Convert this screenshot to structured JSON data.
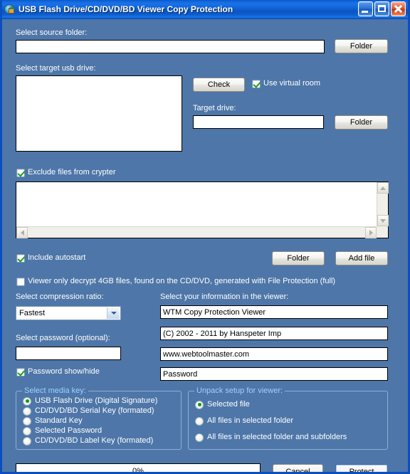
{
  "window": {
    "title": "USB Flash Drive/CD/DVD/BD Viewer Copy Protection",
    "icon": "disc-house-icon",
    "minimize_label": "Minimize",
    "maximize_label": "Maximize",
    "close_label": "Close",
    "accent_titlebar": "#1266dc",
    "background": "#4e76a8",
    "border": "#0a4fbd"
  },
  "source": {
    "label": "Select source folder:",
    "value": "",
    "folder_button": "Folder"
  },
  "target": {
    "label": "Select target usb drive:",
    "list_value": "",
    "check_button": "Check",
    "virtual_room_checkbox": "Use virtual room",
    "virtual_room_checked": true,
    "drive_label": "Target drive:",
    "drive_value": "",
    "drive_folder_button": "Folder"
  },
  "exclude": {
    "checkbox_label": "Exclude files from crypter",
    "checked": true,
    "list_value": ""
  },
  "autostart": {
    "checkbox_label": "Include autostart",
    "checked": true,
    "folder_button": "Folder",
    "add_file_button": "Add file"
  },
  "viewer_decrypt": {
    "checkbox_label": "Viewer only decrypt 4GB files, found on the CD/DVD, generated with File Protection (full)",
    "checked": false
  },
  "compression": {
    "label": "Select compression ratio:",
    "selected": "Fastest",
    "options": [
      "Fastest"
    ]
  },
  "password": {
    "label": "Select password (optional):",
    "value": "",
    "show_hide_checkbox": "Password show/hide",
    "show_hide_checked": true
  },
  "viewer_info": {
    "label": "Select your information in the viewer:",
    "line1": "WTM Copy Protection Viewer",
    "line2": "(C) 2002 - 2011 by Hanspeter Imp",
    "line3": "www.webtoolmaster.com",
    "line4": "Password"
  },
  "media_key": {
    "title": "Select media key:",
    "options": [
      {
        "label": "USB Flash Drive (Digital Signature)",
        "selected": true
      },
      {
        "label": "CD/DVD/BD Serial Key (formated)",
        "selected": false
      },
      {
        "label": "Standard Key",
        "selected": false
      },
      {
        "label": "Selected Password",
        "selected": false
      },
      {
        "label": "CD/DVD/BD Label Key (formated)",
        "selected": false
      }
    ]
  },
  "unpack": {
    "title": "Unpack setup for viewer:",
    "options": [
      {
        "label": "Selected file",
        "selected": true
      },
      {
        "label": "All files in selected folder",
        "selected": false
      },
      {
        "label": "All files in selected folder and subfolders",
        "selected": false
      }
    ]
  },
  "footer": {
    "progress_text": "0%",
    "progress_percent": 0,
    "cancel_button": "Cancel",
    "protect_button": "Protect"
  }
}
